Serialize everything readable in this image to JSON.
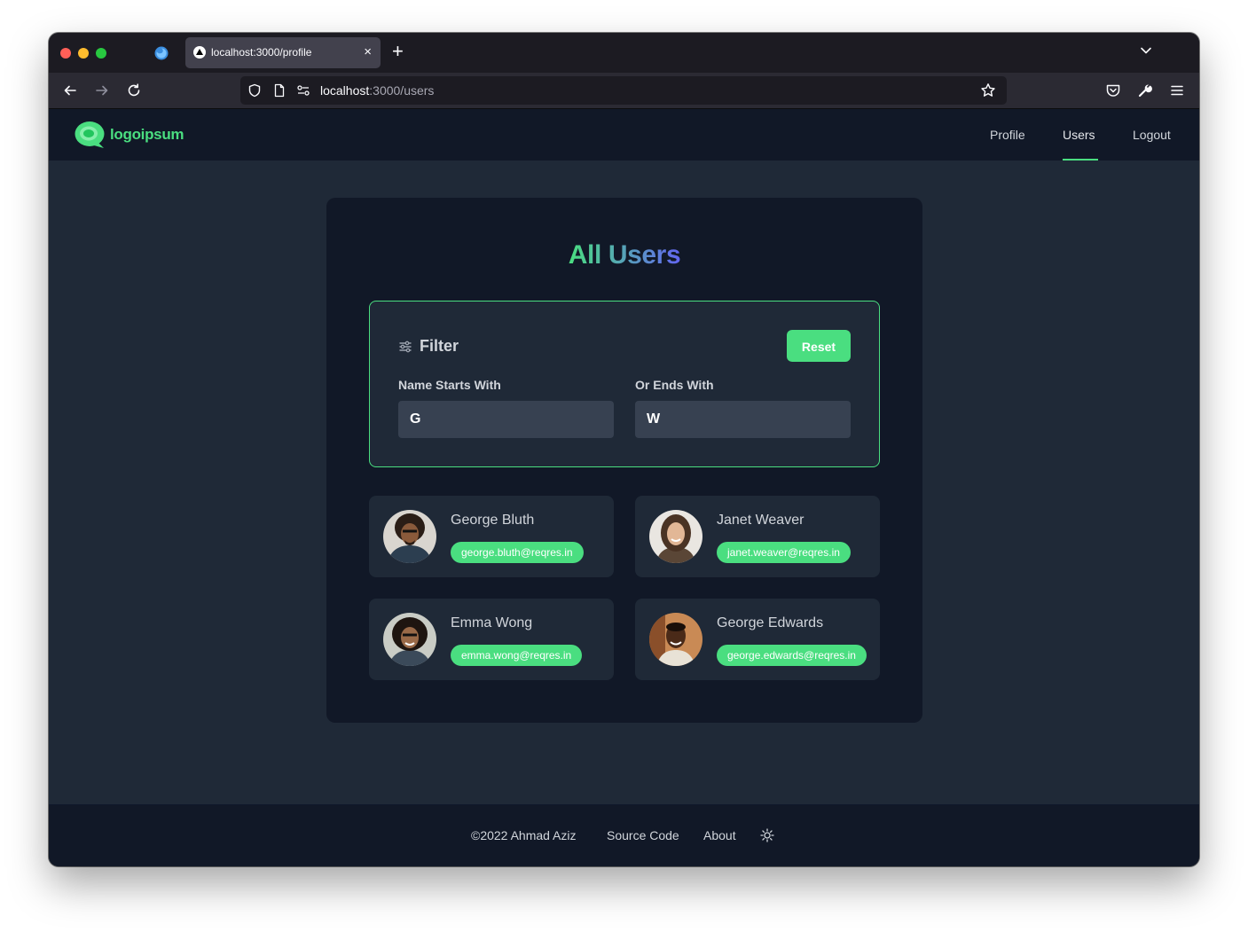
{
  "browser": {
    "tab_title": "localhost:3000/profile",
    "tab_close": "×",
    "new_tab": "+",
    "url_host": "localhost",
    "url_path": ":3000/users"
  },
  "site": {
    "logo_text": "logoipsum",
    "nav": {
      "profile": "Profile",
      "users": "Users",
      "logout": "Logout"
    }
  },
  "main": {
    "title": "All Users",
    "filter": {
      "title": "Filter",
      "reset_label": "Reset",
      "starts_label": "Name Starts With",
      "starts_value": "G",
      "ends_label": "Or Ends With",
      "ends_value": "W"
    },
    "users": [
      {
        "name": "George Bluth",
        "email": "george.bluth@reqres.in"
      },
      {
        "name": "Janet Weaver",
        "email": "janet.weaver@reqres.in"
      },
      {
        "name": "Emma Wong",
        "email": "emma.wong@reqres.in"
      },
      {
        "name": "George Edwards",
        "email": "george.edwards@reqres.in"
      }
    ]
  },
  "footer": {
    "copyright": "©2022 Ahmad Aziz",
    "source": "Source Code",
    "about": "About",
    "theme_icon": "sun-icon"
  },
  "colors": {
    "accent": "#4ade80",
    "gradient_end": "#6366f1",
    "page_bg": "#1f2937",
    "card_bg": "#111827"
  }
}
